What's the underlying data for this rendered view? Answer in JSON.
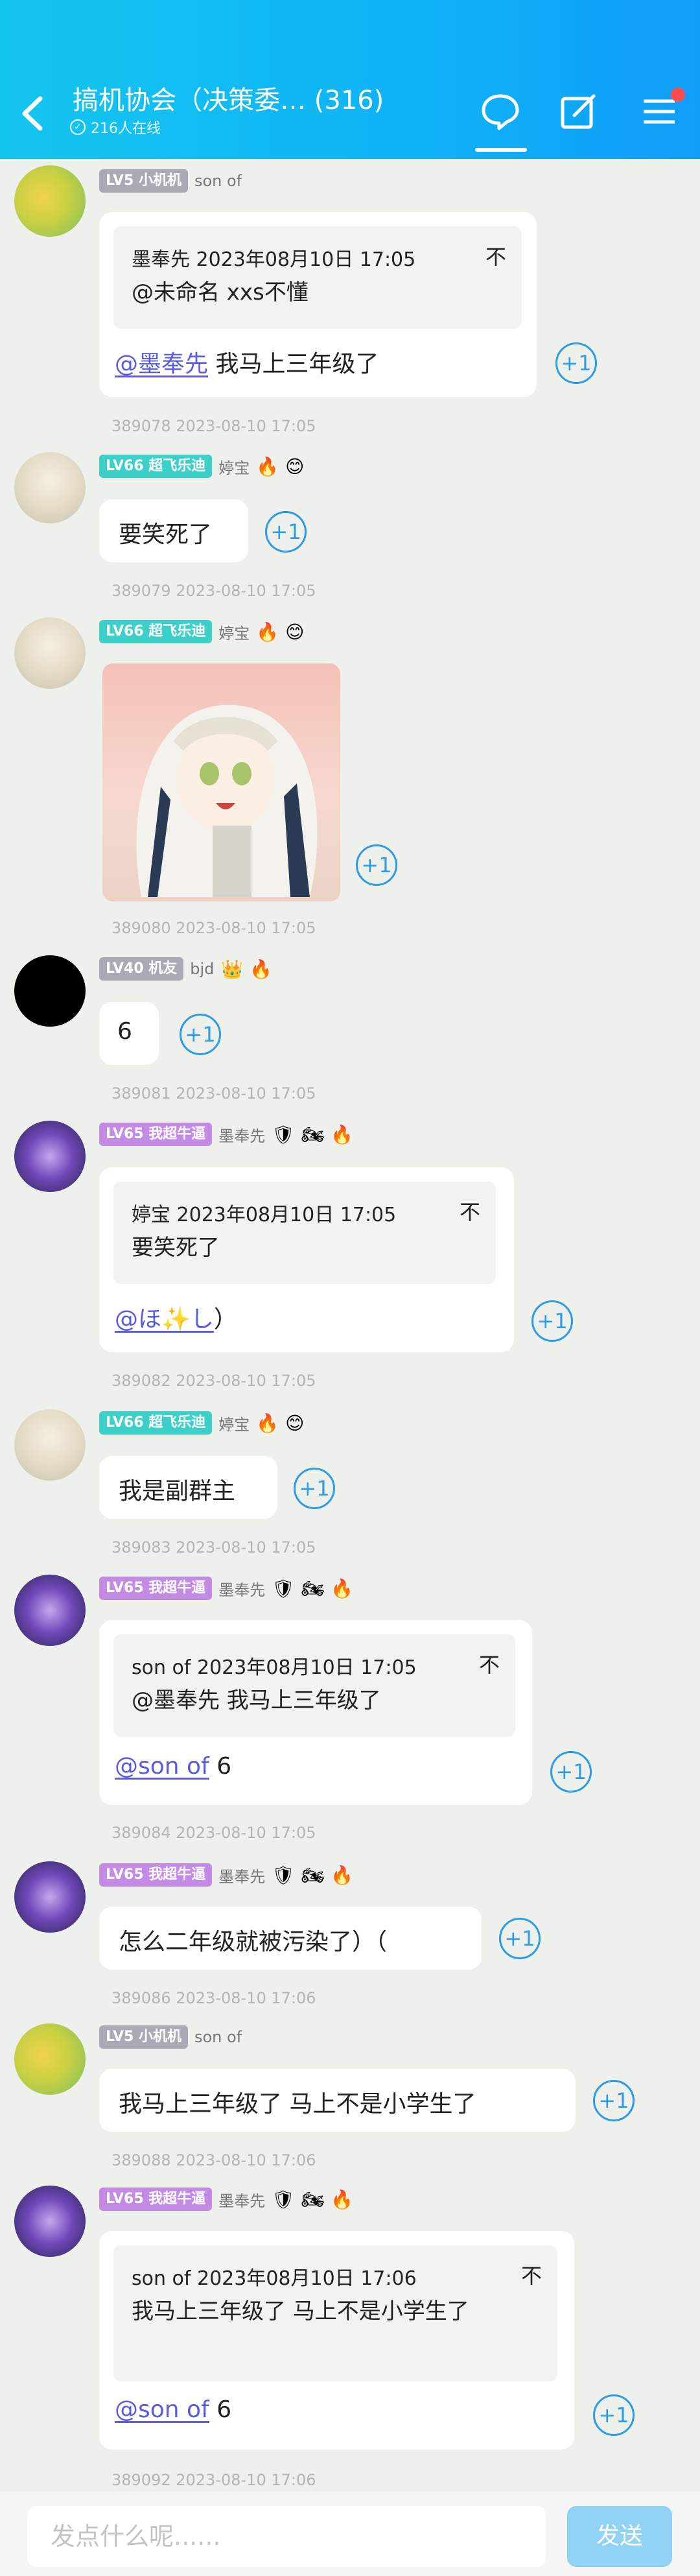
{
  "header": {
    "title": "搞机协会（决策委… (316)",
    "online": "216人在线"
  },
  "colors": {
    "lv_grey": "#a9aab5",
    "lv_teal": "#3cd0c8",
    "lv_purple": "#c38be6",
    "accent": "#2c9be8"
  },
  "messages": [
    {
      "level": "LV5 小机机",
      "nick": "son of",
      "quote_head": "墨奉先 2023年08月10日 17:05",
      "quote_body": "@未命名 xxs不懂",
      "at": "@墨奉先",
      "text": " 我马上三年级了",
      "ts": "389078   2023-08-10 17:05"
    },
    {
      "level": "LV66 超飞乐迪",
      "nick": "婷宝",
      "text": "要笑死了",
      "ts": "389079   2023-08-10 17:05"
    },
    {
      "level": "LV66 超飞乐迪",
      "nick": "婷宝",
      "ts": "389080   2023-08-10 17:05"
    },
    {
      "level": "LV40 机友",
      "nick": "bjd",
      "text": "6",
      "ts": "389081   2023-08-10 17:05"
    },
    {
      "level": "LV65 我超牛逼",
      "nick": "墨奉先",
      "quote_head": "婷宝 2023年08月10日 17:05",
      "quote_body": "要笑死了",
      "at": "@ほ✨し",
      "text": "）",
      "ts": "389082   2023-08-10 17:05"
    },
    {
      "level": "LV66 超飞乐迪",
      "nick": "婷宝",
      "text": "我是副群主",
      "ts": "389083   2023-08-10 17:05"
    },
    {
      "level": "LV65 我超牛逼",
      "nick": "墨奉先",
      "quote_head": "son of 2023年08月10日 17:05",
      "quote_body": "@墨奉先 我马上三年级了",
      "at": "@son of",
      "text": " 6",
      "ts": "389084   2023-08-10 17:05"
    },
    {
      "level": "LV65 我超牛逼",
      "nick": "墨奉先",
      "text": "怎么二年级就被污染了）（",
      "ts": "389086   2023-08-10 17:06"
    },
    {
      "level": "LV5 小机机",
      "nick": "son of",
      "text": "我马上三年级了 马上不是小学生了",
      "ts": "389088   2023-08-10 17:06"
    },
    {
      "level": "LV65 我超牛逼",
      "nick": "墨奉先",
      "quote_head": "son of 2023年08月10日 17:06",
      "quote_body": "我马上三年级了 马上不是小学生了",
      "at": "@son of",
      "text": " 6",
      "ts": "389092   2023-08-10 17:06"
    }
  ],
  "plus_label": "+1",
  "close_glyph": "不",
  "input_placeholder": "发点什么呢......",
  "send_label": "发送"
}
